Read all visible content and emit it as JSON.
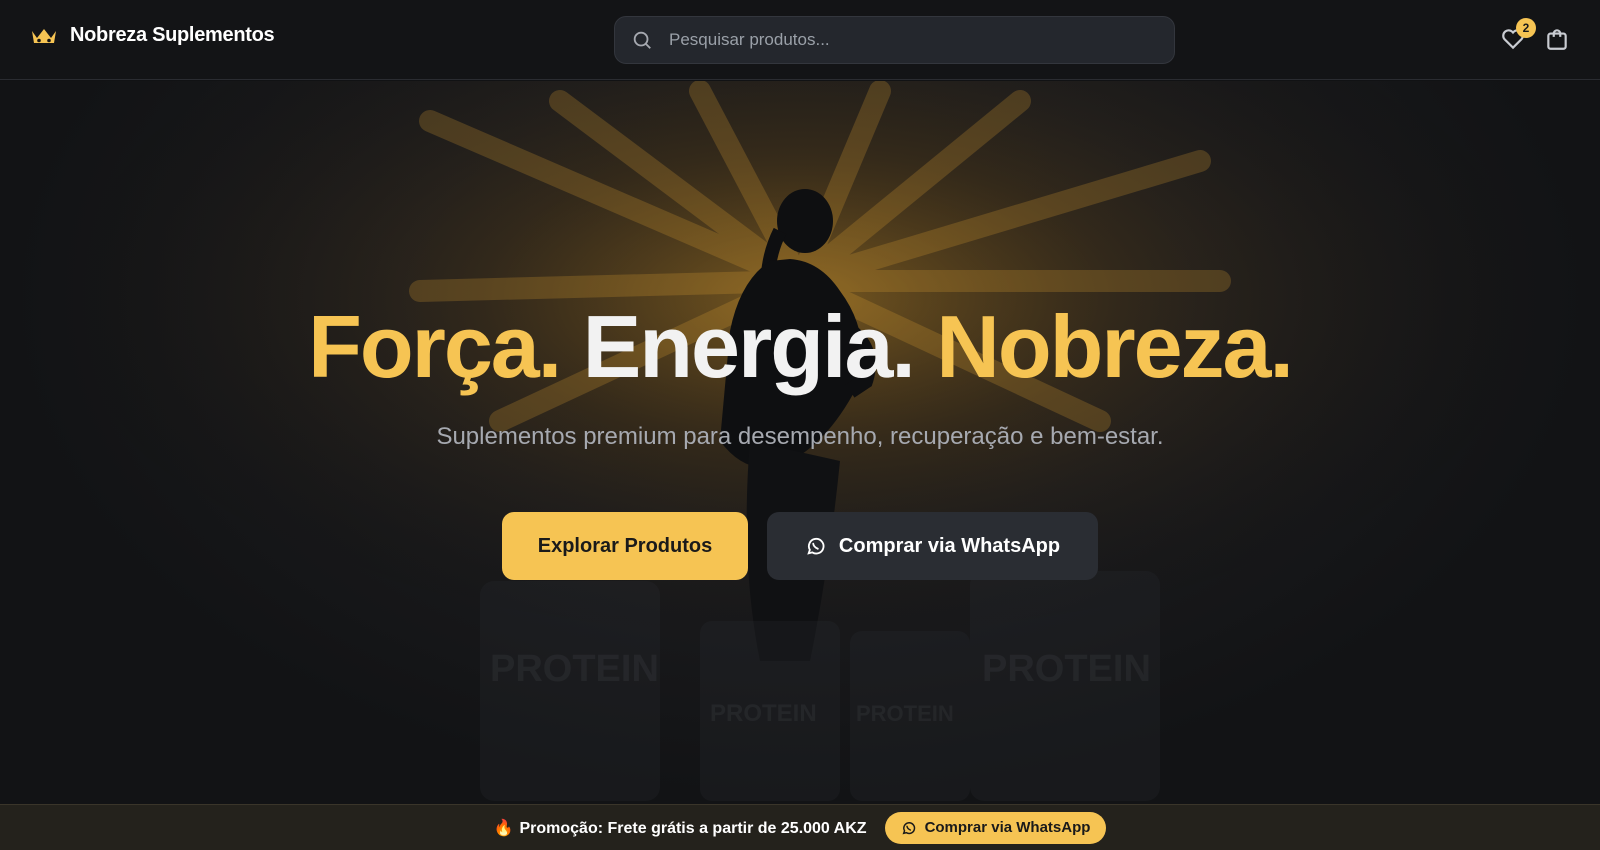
{
  "header": {
    "brand_name": "Nobreza Suplementos",
    "search_placeholder": "Pesquisar produtos...",
    "wishlist_count": "2"
  },
  "hero": {
    "headline_1": "Força.",
    "headline_2": "Energia.",
    "headline_3": "Nobreza.",
    "subtitle": "Suplementos premium para desempenho, recuperação e bem-estar.",
    "primary_button": "Explorar Produtos",
    "secondary_button": "Comprar via WhatsApp",
    "jar_label": "PROTEIN"
  },
  "promo": {
    "text": "Promoção: Frete grátis a partir de 25.000 AKZ",
    "button": "Comprar via WhatsApp"
  },
  "colors": {
    "accent": "#f6c453",
    "background": "#121315",
    "surface": "#2a2d33"
  },
  "icons": {
    "brand": "crown-icon",
    "search": "search-icon",
    "wishlist": "heart-icon",
    "cart": "shopping-bag-icon",
    "whatsapp": "whatsapp-icon",
    "promo": "fire-icon"
  }
}
